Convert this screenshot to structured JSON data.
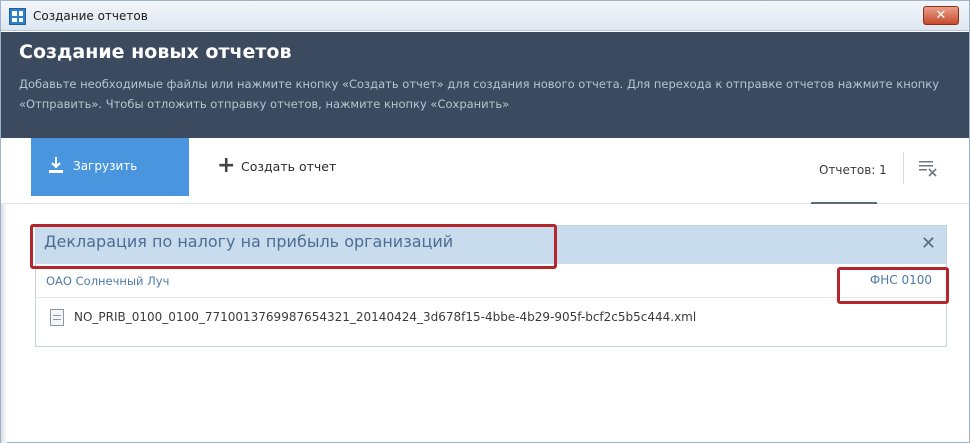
{
  "window": {
    "title": "Создание отчетов",
    "close_label": "✕"
  },
  "header": {
    "title": "Создание новых отчетов",
    "description": "Добавьте необходимые файлы или нажмите кнопку «Создать отчет» для создания нового отчета. Для перехода к отправке отчетов нажмите кнопку «Отправить». Чтобы отложить отправку отчетов, нажмите кнопку «Сохранить»"
  },
  "toolbar": {
    "upload_label": "Загрузить",
    "create_label": "Создать отчет",
    "create_icon": "+",
    "report_count": "Отчетов: 1"
  },
  "report": {
    "title": "Декларация по налогу на прибыль организаций",
    "close_label": "✕",
    "organization": "ОАО Солнечный Луч",
    "fns_code": "ФНС 0100",
    "file_name": "NO_PRIB_0100_0100_7710013769987654321_20140424_3d678f15-4bbe-4b29-905f-bcf2c5b5c444.xml"
  },
  "colors": {
    "header_bg": "#3b4a5e",
    "upload_button": "#4a96de",
    "panel_head": "#c9dcee",
    "highlight": "#b3262b"
  },
  "icons": {
    "app": "app-grid-icon",
    "upload": "upload-icon",
    "create": "plus-icon",
    "filter": "filter-clear-icon",
    "file": "xml-file-icon"
  }
}
